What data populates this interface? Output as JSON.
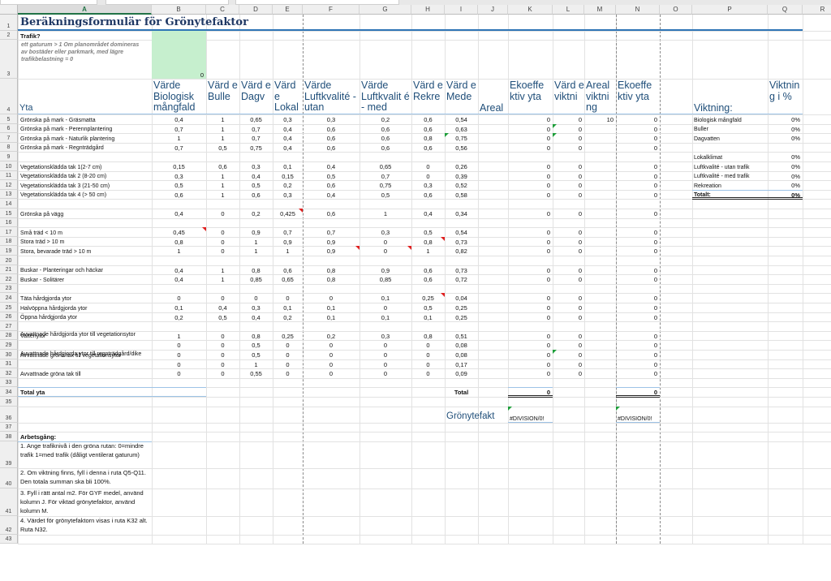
{
  "columns": [
    "A",
    "B",
    "C",
    "D",
    "E",
    "F",
    "G",
    "H",
    "I",
    "J",
    "K",
    "L",
    "M",
    "N",
    "O",
    "P",
    "Q",
    "R"
  ],
  "selected_column": "A",
  "title": "Beräkningsformulär för Grönytefaktor",
  "trafik_label": "Trafik?",
  "trafik_note": "ett gaturum > 1 Om planområdet domineras av bostäder eller parkmark, med lägre trafikbelastning = 0",
  "trafik_value": "0",
  "headers": {
    "yta": "Yta",
    "B": "Värde Biologisk mångfald",
    "C": "Värd e Bulle",
    "D": "Värd e Dagv",
    "E": "Värd e Lokal",
    "F": "Värde Luftkvalité - utan",
    "G": "Värde Luftkvalit é - med",
    "H": "Värd e Rekre",
    "I": "Värd e Mede",
    "J": "Areal",
    "K": "Ekoeffe ktiv yta",
    "L": "Värd e viktni",
    "M": "Areal viktni ng",
    "N": "Ekoeffe ktiv yta",
    "P": "Viktning:",
    "Q": "Viktnin g i %"
  },
  "rows": [
    {
      "r": "5",
      "a": "Grönska på mark - Gräsmatta",
      "b": "0,4",
      "c": "1",
      "d": "0,65",
      "e": "0,3",
      "f": "0,3",
      "g": "0,2",
      "h": "0,6",
      "i": "0,54",
      "k": "0",
      "l": "0",
      "m": "10",
      "n": "0"
    },
    {
      "r": "6",
      "a": "Grönska på mark - Perennplantering",
      "b": "0,7",
      "c": "1",
      "d": "0,7",
      "e": "0,4",
      "f": "0,6",
      "g": "0,6",
      "h": "0,6",
      "i": "0,63",
      "k": "0",
      "l": "0",
      "m": "",
      "n": "0"
    },
    {
      "r": "7",
      "a": "Grönska på mark - Naturlik plantering",
      "b": "1",
      "c": "1",
      "d": "0,7",
      "e": "0,4",
      "f": "0,6",
      "g": "0,6",
      "h": "0,8",
      "i": "0,75",
      "k": "0",
      "l": "0",
      "m": "",
      "n": "0"
    },
    {
      "r": "8",
      "a": "Grönska på mark - Regnträdgård",
      "b": "0,7",
      "c": "0,5",
      "d": "0,75",
      "e": "0,4",
      "f": "0,6",
      "g": "0,6",
      "h": "0,6",
      "i": "0,56",
      "k": "0",
      "l": "0",
      "m": "",
      "n": "0"
    },
    {
      "r": "10",
      "a": "Vegetationsklädda tak 1(2-7 cm)",
      "b": "0,15",
      "c": "0,6",
      "d": "0,3",
      "e": "0,1",
      "f": "0,4",
      "g": "0,65",
      "h": "0",
      "i": "0,26",
      "k": "0",
      "l": "0",
      "m": "",
      "n": "0"
    },
    {
      "r": "11",
      "a": "Vegetationsklädda tak 2 (8-20 cm)",
      "b": "0,3",
      "c": "1",
      "d": "0,4",
      "e": "0,15",
      "f": "0,5",
      "g": "0,7",
      "h": "0",
      "i": "0,39",
      "k": "0",
      "l": "0",
      "m": "",
      "n": "0"
    },
    {
      "r": "12",
      "a": "Vegetationsklädda tak 3 (21-50 cm)",
      "b": "0,5",
      "c": "1",
      "d": "0,5",
      "e": "0,2",
      "f": "0,6",
      "g": "0,75",
      "h": "0,3",
      "i": "0,52",
      "k": "0",
      "l": "0",
      "m": "",
      "n": "0"
    },
    {
      "r": "13",
      "a": "Vegetationsklädda tak 4 (> 50 cm)",
      "b": "0,6",
      "c": "1",
      "d": "0,6",
      "e": "0,3",
      "f": "0,4",
      "g": "0,5",
      "h": "0,6",
      "i": "0,58",
      "k": "0",
      "l": "0",
      "m": "",
      "n": "0"
    },
    {
      "r": "15",
      "a": "Grönska på vägg",
      "b": "0,4",
      "c": "0",
      "d": "0,2",
      "e": "0,425",
      "f": "0,6",
      "g": "1",
      "h": "0,4",
      "i": "0,34",
      "k": "0",
      "l": "0",
      "m": "",
      "n": "0"
    },
    {
      "r": "17",
      "a": "Små träd < 10 m",
      "b": "0,45",
      "c": "0",
      "d": "0,9",
      "e": "0,7",
      "f": "0,7",
      "g": "0,3",
      "h": "0,5",
      "i": "0,54",
      "k": "0",
      "l": "0",
      "m": "",
      "n": "0"
    },
    {
      "r": "18",
      "a": "Stora träd > 10 m",
      "b": "0,8",
      "c": "0",
      "d": "1",
      "e": "0,9",
      "f": "0,9",
      "g": "0",
      "h": "0,8",
      "i": "0,73",
      "k": "0",
      "l": "0",
      "m": "",
      "n": "0"
    },
    {
      "r": "19",
      "a": "Stora, bevarade träd > 10 m",
      "b": "1",
      "c": "0",
      "d": "1",
      "e": "1",
      "f": "0,9",
      "g": "0",
      "h": "1",
      "i": "0,82",
      "k": "0",
      "l": "0",
      "m": "",
      "n": "0"
    },
    {
      "r": "21",
      "a": "Buskar - Planteringar och häckar",
      "b": "0,4",
      "c": "1",
      "d": "0,8",
      "e": "0,6",
      "f": "0,8",
      "g": "0,9",
      "h": "0,6",
      "i": "0,73",
      "k": "0",
      "l": "0",
      "m": "",
      "n": "0"
    },
    {
      "r": "22",
      "a": "Buskar - Solitärer",
      "b": "0,4",
      "c": "1",
      "d": "0,85",
      "e": "0,65",
      "f": "0,8",
      "g": "0,85",
      "h": "0,6",
      "i": "0,72",
      "k": "0",
      "l": "0",
      "m": "",
      "n": "0"
    },
    {
      "r": "24",
      "a": "Täta hårdgjorda ytor",
      "b": "0",
      "c": "0",
      "d": "0",
      "e": "0",
      "f": "0",
      "g": "0,1",
      "h": "0,25",
      "i": "0,04",
      "k": "0",
      "l": "0",
      "m": "",
      "n": "0"
    },
    {
      "r": "25",
      "a": "Halvöppna hårdgjorda ytor",
      "b": "0,1",
      "c": "0,4",
      "d": "0,3",
      "e": "0,1",
      "f": "0,1",
      "g": "0",
      "h": "0,5",
      "i": "0,25",
      "k": "0",
      "l": "0",
      "m": "",
      "n": "0"
    },
    {
      "r": "26",
      "a": "Öppna hårdgjorda ytor",
      "b": "0,2",
      "c": "0,5",
      "d": "0,4",
      "e": "0,2",
      "f": "0,1",
      "g": "0,1",
      "h": "0,1",
      "i": "0,25",
      "k": "0",
      "l": "0",
      "m": "",
      "n": "0"
    },
    {
      "r": "28",
      "a": "Vattenytor",
      "b": "1",
      "c": "0",
      "d": "0,8",
      "e": "0,25",
      "f": "0,2",
      "g": "0,3",
      "h": "0,8",
      "i": "0,51",
      "k": "0",
      "l": "0",
      "m": "",
      "n": "0"
    },
    {
      "r": "29",
      "a": "Avvattnade hårdgjorda ytor till vegetationsytor",
      "b": "0",
      "c": "0",
      "d": "0,5",
      "e": "0",
      "f": "0",
      "g": "0",
      "h": "0",
      "i": "0,08",
      "k": "0",
      "l": "0",
      "m": "",
      "n": "0"
    },
    {
      "r": "30",
      "a": "Avvattnade gröna tak till vegetationsytor",
      "b": "0",
      "c": "0",
      "d": "0,5",
      "e": "0",
      "f": "0",
      "g": "0",
      "h": "0",
      "i": "0,08",
      "k": "0",
      "l": "0",
      "m": "",
      "n": "0"
    },
    {
      "r": "31",
      "a": "Avvattnade hårdgjorda ytor till regnträdgård/dike",
      "b": "0",
      "c": "0",
      "d": "1",
      "e": "0",
      "f": "0",
      "g": "0",
      "h": "0",
      "i": "0,17",
      "k": "0",
      "l": "0",
      "m": "",
      "n": "0"
    },
    {
      "r": "32",
      "a": "Avvattnade gröna tak till",
      "b": "0",
      "c": "0",
      "d": "0,55",
      "e": "0",
      "f": "0",
      "g": "0",
      "h": "0",
      "i": "0,09",
      "k": "0",
      "l": "0",
      "m": "",
      "n": "0"
    }
  ],
  "weights": [
    {
      "r": "5",
      "label": "Biologisk mångfald",
      "value": "0%"
    },
    {
      "r": "6",
      "label": "Buller",
      "value": "0%"
    },
    {
      "r": "7",
      "label": "Dagvatten",
      "value": "0%"
    },
    {
      "r": "9",
      "label": "Lokalklimat",
      "value": "0%"
    },
    {
      "r": "10",
      "label": "Luftkvalité - utan trafik",
      "value": "0%"
    },
    {
      "r": "11",
      "label": "Luftkvalité - med trafik",
      "value": "0%"
    },
    {
      "r": "12",
      "label": "Rekreation",
      "value": "0%"
    },
    {
      "r": "13",
      "label": "Totalt:",
      "value": "0%"
    }
  ],
  "total": {
    "label_a": "Total yta",
    "label_i": "Total",
    "k": "0",
    "n": "0"
  },
  "gyf": {
    "label": "Grönytefakt",
    "k": "#DIVISION/0!",
    "n": "#DIVISION/0!"
  },
  "arbetsgang": {
    "label": "Arbetsgång:",
    "steps": [
      "1. Ange trafiknivå i den gröna rutan: 0=mindre trafik 1=med trafik (dåligt ventilerat gaturum)",
      "2. Om viktning finns, fyll i denna i ruta Q5-Q11. Den totala summan ska bli 100%.",
      "3. Fyll i rätt antal m2. För GYF medel, använd kolumn J. För viktad grönytefaktor, använd kolumn M.",
      "4. Värdet för grönytefaktorn visas i ruta K32 alt. Ruta N32."
    ]
  }
}
